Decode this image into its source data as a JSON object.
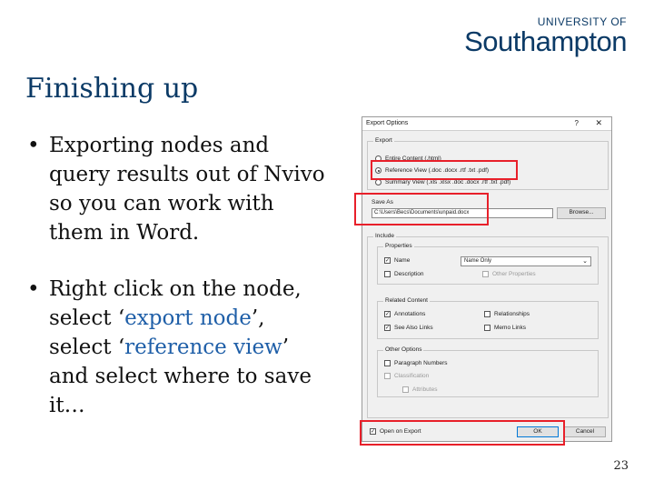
{
  "logo": {
    "top": "UNIVERSITY OF",
    "main": "Southampton"
  },
  "slide": {
    "title": "Finishing up",
    "bullets": [
      {
        "text": "Exporting nodes and query results out of Nvivo so you can work with them in Word."
      },
      {
        "pre": "Right click on the node, select ‘",
        "hl1": "export node",
        "mid": "’, select ‘",
        "hl2": "reference view",
        "post": "’ and select where to save it…"
      }
    ],
    "page_number": "23"
  },
  "dialog": {
    "title": "Export Options",
    "help": "?",
    "close": "✕",
    "export_group": "Export",
    "export_options": [
      {
        "label": "Entire Content (.html)",
        "selected": false
      },
      {
        "label": "Reference View (.doc .docx .rtf .txt .pdf)",
        "selected": true
      },
      {
        "label": "Summary View (.xls .xlsx .doc .docx .rtf .txt .pdf)",
        "selected": false
      }
    ],
    "save_as_label": "Save As",
    "save_as_value": "C:\\Users\\Becs\\Documents\\unpaid.docx",
    "browse": "Browse...",
    "include_group": "Include",
    "properties_group": "Properties",
    "name_label": "Name",
    "name_select": "Name Only",
    "description_label": "Description",
    "other_properties": "Other Properties",
    "related_group": "Related Content",
    "annotations": "Annotations",
    "relationships": "Relationships",
    "see_also": "See Also Links",
    "memo_links": "Memo Links",
    "other_group": "Other Options",
    "paragraph_numbers": "Paragraph Numbers",
    "classification": "Classification",
    "attributes": "Attributes",
    "open_on_export": "Open on Export",
    "ok": "OK",
    "cancel": "Cancel",
    "check_mark": "✓",
    "chevron": "⌄",
    "highlight_color": "#e8202a"
  }
}
